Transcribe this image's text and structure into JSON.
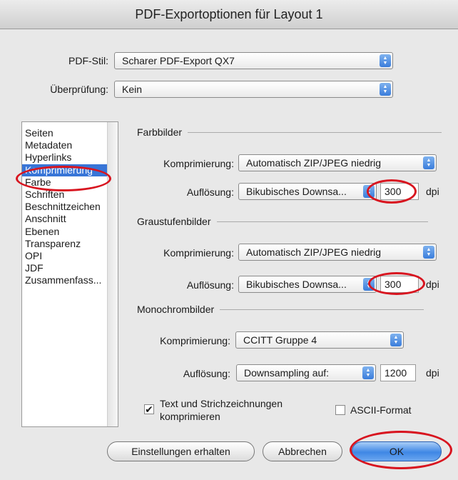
{
  "window": {
    "title": "PDF-Exportoptionen für Layout 1"
  },
  "header": {
    "pdf_stil_label": "PDF-Stil:",
    "pdf_stil_value": "Scharer PDF-Export QX7",
    "ueberpruefung_label": "Überprüfung:",
    "ueberpruefung_value": "Kein"
  },
  "sidebar": {
    "items": [
      {
        "label": "Seiten"
      },
      {
        "label": "Metadaten"
      },
      {
        "label": "Hyperlinks"
      },
      {
        "label": "Komprimierung"
      },
      {
        "label": "Farbe"
      },
      {
        "label": "Schriften"
      },
      {
        "label": "Beschnittzeichen"
      },
      {
        "label": "Anschnitt"
      },
      {
        "label": "Ebenen"
      },
      {
        "label": "Transparenz"
      },
      {
        "label": "OPI"
      },
      {
        "label": "JDF"
      },
      {
        "label": "Zusammenfass..."
      }
    ],
    "selected": "Komprimierung"
  },
  "farbbilder": {
    "title": "Farbbilder",
    "komprimierung_label": "Komprimierung:",
    "komprimierung_value": "Automatisch ZIP/JPEG niedrig",
    "aufloesung_label": "Auflösung:",
    "aufloesung_value": "Bikubisches Downsa...",
    "dpi_value": "300",
    "dpi_unit": "dpi"
  },
  "graustufenbilder": {
    "title": "Graustufenbilder",
    "komprimierung_label": "Komprimierung:",
    "komprimierung_value": "Automatisch ZIP/JPEG niedrig",
    "aufloesung_label": "Auflösung:",
    "aufloesung_value": "Bikubisches Downsa...",
    "dpi_value": "300",
    "dpi_unit": "dpi"
  },
  "monochrombilder": {
    "title": "Monochrombilder",
    "komprimierung_label": "Komprimierung:",
    "komprimierung_value": "CCITT Gruppe 4",
    "aufloesung_label": "Auflösung:",
    "aufloesung_value": "Downsampling auf:",
    "dpi_value": "1200",
    "dpi_unit": "dpi"
  },
  "options": {
    "text_compress_label_line1": "Text und Strichzeichnungen",
    "text_compress_label_line2": "komprimieren",
    "text_compress_checked": true,
    "ascii_label": "ASCII-Format",
    "ascii_checked": false
  },
  "buttons": {
    "keep_settings": "Einstellungen erhalten",
    "cancel": "Abbrechen",
    "ok": "OK"
  },
  "annotation_color": "#d8141f"
}
